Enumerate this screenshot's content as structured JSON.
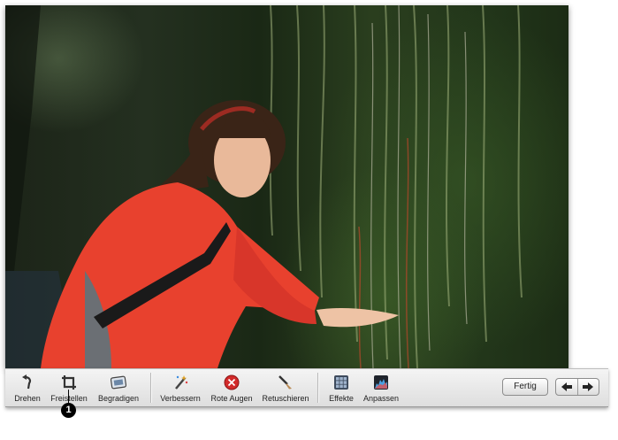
{
  "toolbar": {
    "tools": [
      {
        "label": "Drehen",
        "icon": "rotate-icon"
      },
      {
        "label": "Freistellen",
        "icon": "crop-icon"
      },
      {
        "label": "Begradigen",
        "icon": "straighten-icon"
      },
      {
        "label": "Verbessern",
        "icon": "magic-wand-icon"
      },
      {
        "label": "Rote Augen",
        "icon": "red-eye-icon"
      },
      {
        "label": "Retuschieren",
        "icon": "brush-icon"
      },
      {
        "label": "Effekte",
        "icon": "effects-grid-icon"
      },
      {
        "label": "Anpassen",
        "icon": "histogram-icon"
      }
    ],
    "done_label": "Fertig",
    "prev_icon": "arrow-left-icon",
    "next_icon": "arrow-right-icon"
  },
  "callout": {
    "number": "1"
  },
  "colors": {
    "jacket": "#e8412e",
    "foliage": "#2f4a1f",
    "toolbar": "#e8e8e8"
  }
}
